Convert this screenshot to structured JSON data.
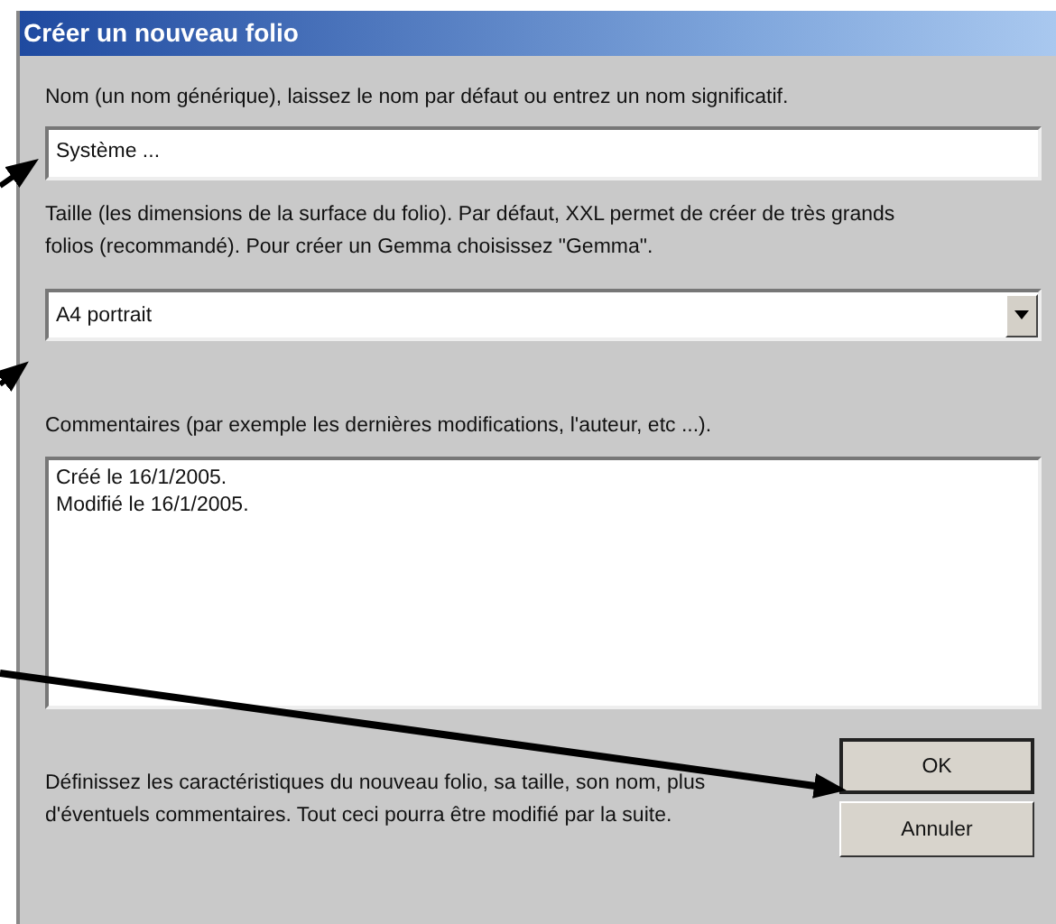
{
  "window": {
    "title": "Créer un nouveau folio"
  },
  "name_field": {
    "label": "Nom (un nom générique), laissez le nom par défaut ou entrez un nom significatif.",
    "value": "Système ..."
  },
  "size_field": {
    "label": "Taille (les dimensions de la surface du folio). Par défaut, XXL permet de créer de très grands folios (recommandé). Pour créer un Gemma choisissez \"Gemma\".",
    "value": "A4 portrait"
  },
  "comments_field": {
    "label": "Commentaires (par exemple les dernières modifications, l'auteur, etc ...).",
    "lines": [
      "Créé le 16/1/2005.",
      "Modifié le 16/1/2005."
    ]
  },
  "hint": "Définissez les caractéristiques du nouveau folio, sa taille, son nom, plus d'éventuels commentaires. Tout ceci pourra être modifié par la suite.",
  "buttons": [
    {
      "label": "OK",
      "default": true
    },
    {
      "label": "Annuler",
      "default": false
    }
  ]
}
